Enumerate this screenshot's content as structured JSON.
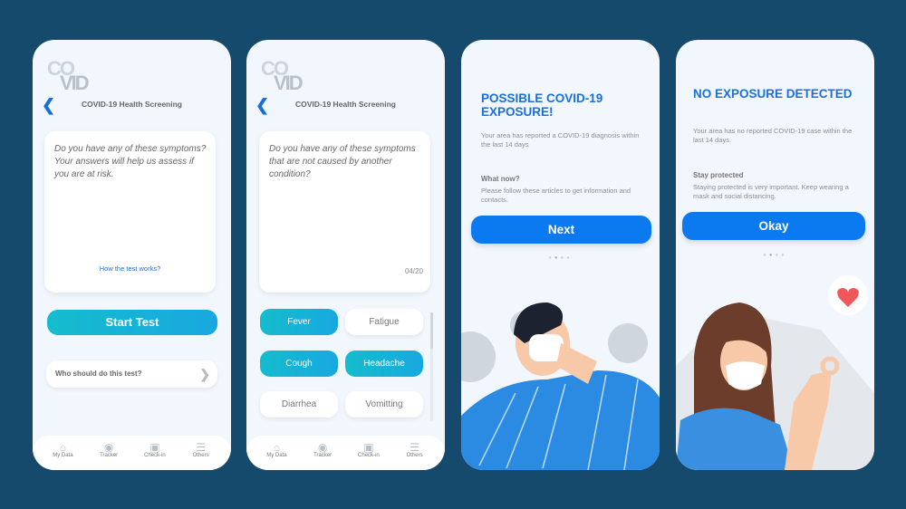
{
  "logo": {
    "line1": "CO",
    "line2": "VID"
  },
  "screen1": {
    "header_title": "COVID-19 Health Screening",
    "question": "Do you have any of these symptoms? Your answers will help us assess if you are at risk.",
    "link": "How the test works?",
    "start_button": "Start Test",
    "who_row": "Who should do this test?"
  },
  "screen2": {
    "header_title": "COVID-19 Health Screening",
    "question": "Do you have any of these symptoms that are not caused by another condition?",
    "counter": "04/20",
    "chips": [
      {
        "label": "Fever",
        "selected": true
      },
      {
        "label": "Fatigue",
        "selected": false
      },
      {
        "label": "Cough",
        "selected": true
      },
      {
        "label": "Headache",
        "selected": true
      },
      {
        "label": "Diarrhea",
        "selected": false
      },
      {
        "label": "Vomitting",
        "selected": false
      }
    ]
  },
  "nav": [
    {
      "label": "My Data",
      "icon": "home-icon"
    },
    {
      "label": "Tracker",
      "icon": "target-icon"
    },
    {
      "label": "Check-in",
      "icon": "scan-icon"
    },
    {
      "label": "Others",
      "icon": "menu-icon"
    }
  ],
  "screen3": {
    "title": "POSSIBLE COVID-19 EXPOSURE!",
    "body": "Your area has reported a COVID-19 diagnosis within the last 14 days",
    "subheading": "What now?",
    "subbody": "Please follow these articles to get information and contacts.",
    "button": "Next",
    "active_dot": 2
  },
  "screen4": {
    "title": "NO EXPOSURE DETECTED",
    "body": "Your area has no reported COVID-19 case within the last 14 days.",
    "subheading": "Stay protected",
    "subbody": "Staying protected is very important. Keep wearing a mask and social distancing.",
    "button": "Okay",
    "active_dot": 2
  },
  "colors": {
    "background": "#154a6c",
    "primary": "#0b7af0",
    "accent_gradient": [
      "#15bccd",
      "#18a8e0"
    ],
    "title_blue": "#1a6fe0"
  }
}
